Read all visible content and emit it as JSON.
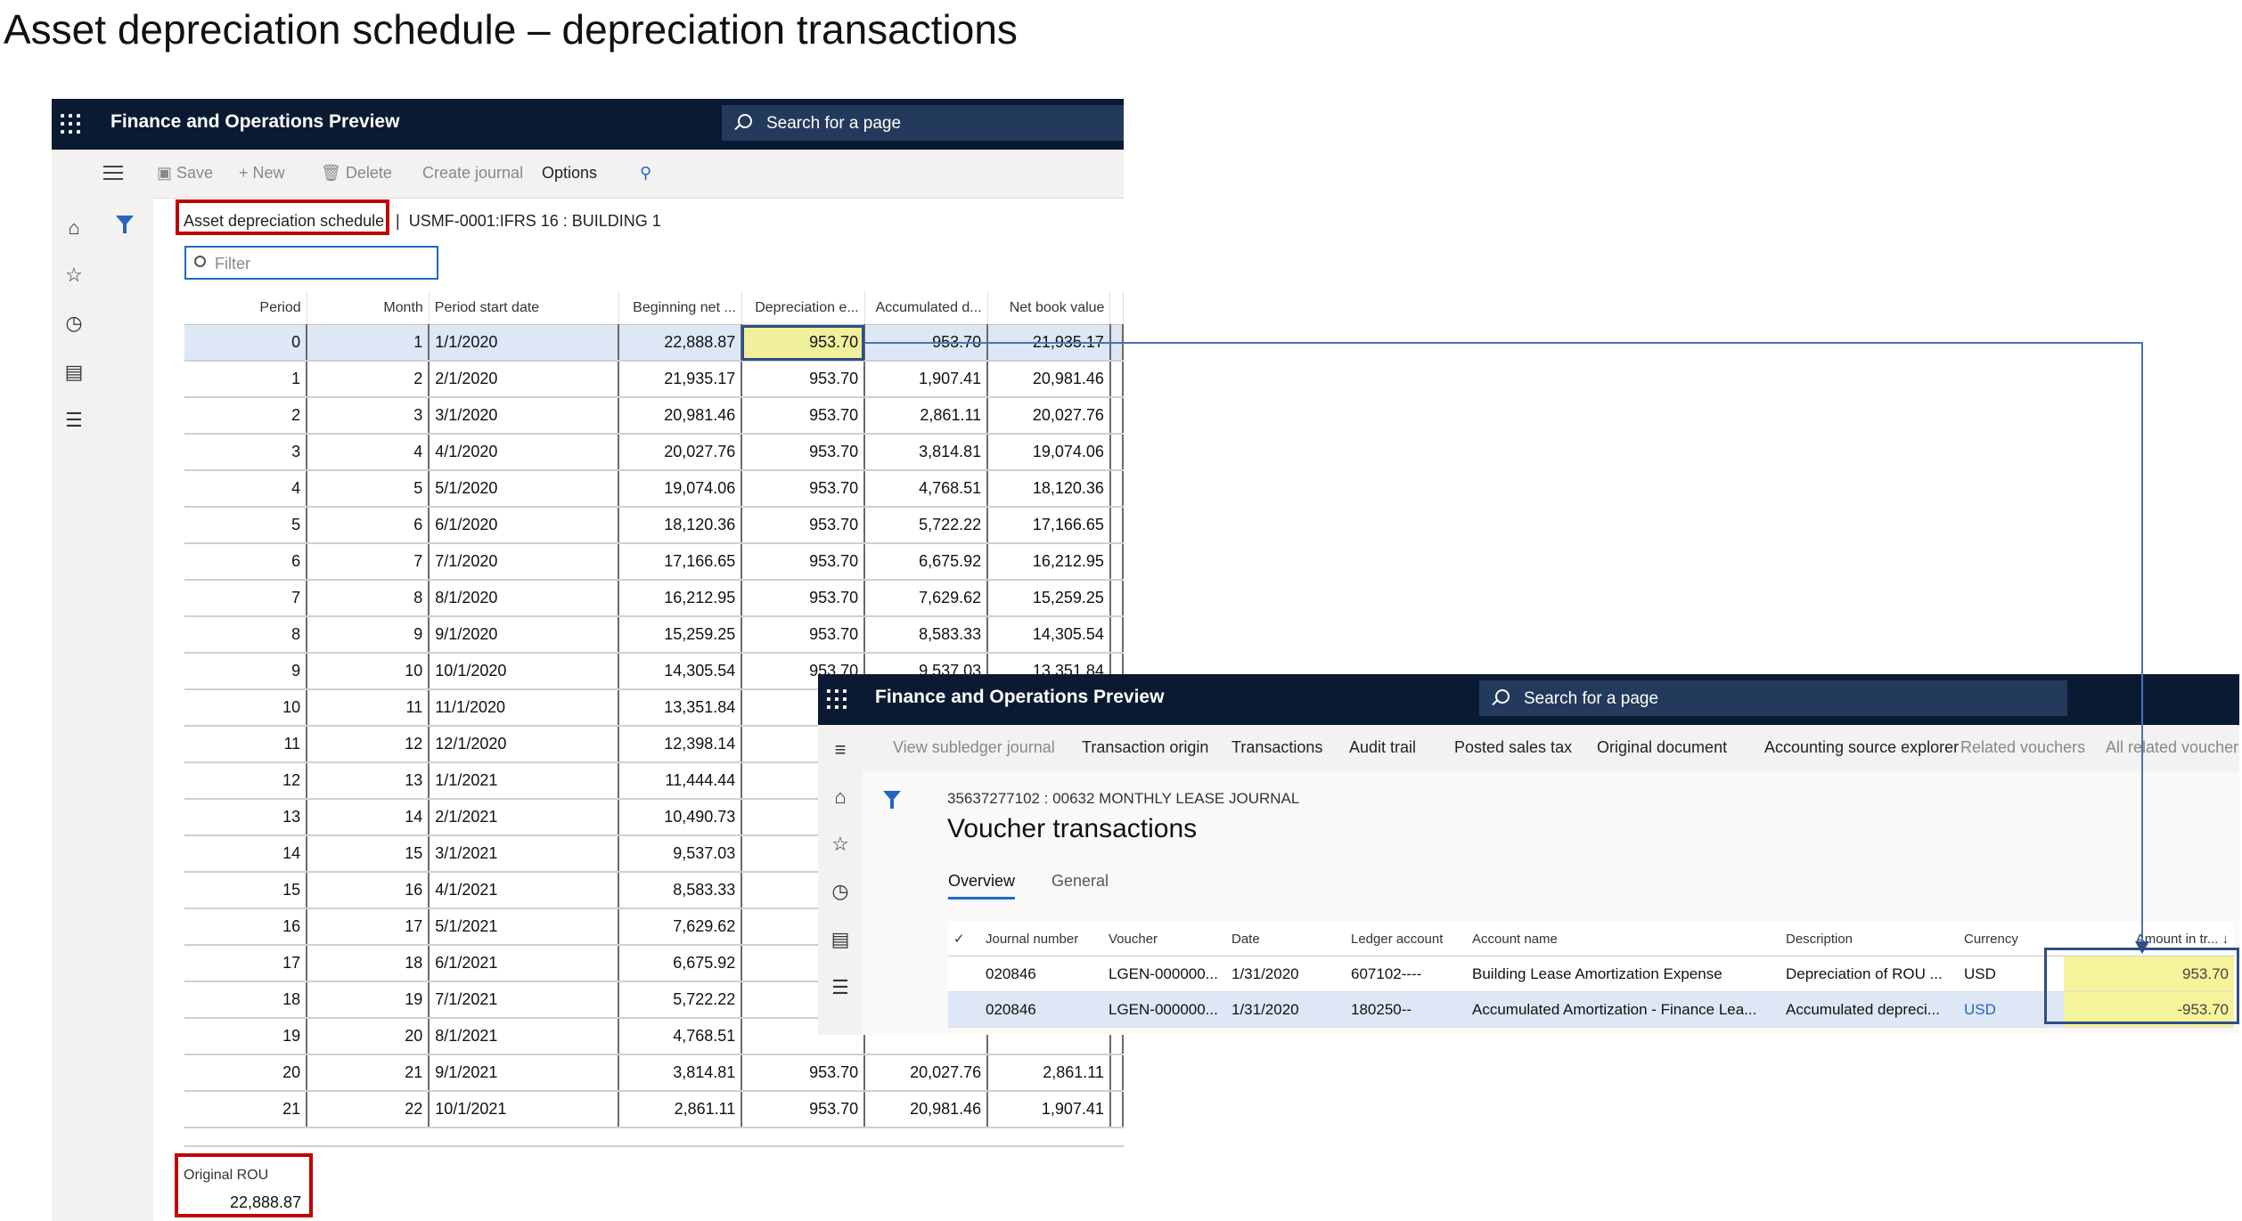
{
  "slide_title": "Asset depreciation schedule – depreciation transactions",
  "app_title": "Finance and Operations Preview",
  "search_placeholder": "Search for a page",
  "schedule": {
    "actions": [
      "Save",
      "New",
      "Delete",
      "Create journal",
      "Options"
    ],
    "breadcrumb": "Asset depreciation schedule",
    "breadcrumb_separator": "|",
    "asset_ref": "USMF-0001:IFRS 16 : BUILDING 1",
    "filter_placeholder": "Filter",
    "columns": [
      "Period",
      "Month",
      "Period start date",
      "Beginning net ...",
      "Depreciation e...",
      "Accumulated d...",
      "Net book value"
    ],
    "rows": [
      [
        "0",
        "1",
        "1/1/2020",
        "22,888.87",
        "953.70",
        "953.70",
        "21,935.17"
      ],
      [
        "1",
        "2",
        "2/1/2020",
        "21,935.17",
        "953.70",
        "1,907.41",
        "20,981.46"
      ],
      [
        "2",
        "3",
        "3/1/2020",
        "20,981.46",
        "953.70",
        "2,861.11",
        "20,027.76"
      ],
      [
        "3",
        "4",
        "4/1/2020",
        "20,027.76",
        "953.70",
        "3,814.81",
        "19,074.06"
      ],
      [
        "4",
        "5",
        "5/1/2020",
        "19,074.06",
        "953.70",
        "4,768.51",
        "18,120.36"
      ],
      [
        "5",
        "6",
        "6/1/2020",
        "18,120.36",
        "953.70",
        "5,722.22",
        "17,166.65"
      ],
      [
        "6",
        "7",
        "7/1/2020",
        "17,166.65",
        "953.70",
        "6,675.92",
        "16,212.95"
      ],
      [
        "7",
        "8",
        "8/1/2020",
        "16,212.95",
        "953.70",
        "7,629.62",
        "15,259.25"
      ],
      [
        "8",
        "9",
        "9/1/2020",
        "15,259.25",
        "953.70",
        "8,583.33",
        "14,305.54"
      ],
      [
        "9",
        "10",
        "10/1/2020",
        "14,305.54",
        "953.70",
        "9,537.03",
        "13,351.84"
      ],
      [
        "10",
        "11",
        "11/1/2020",
        "13,351.84",
        "",
        "",
        ""
      ],
      [
        "11",
        "12",
        "12/1/2020",
        "12,398.14",
        "",
        "",
        ""
      ],
      [
        "12",
        "13",
        "1/1/2021",
        "11,444.44",
        "",
        "",
        ""
      ],
      [
        "13",
        "14",
        "2/1/2021",
        "10,490.73",
        "",
        "",
        ""
      ],
      [
        "14",
        "15",
        "3/1/2021",
        "9,537.03",
        "",
        "",
        ""
      ],
      [
        "15",
        "16",
        "4/1/2021",
        "8,583.33",
        "",
        "",
        ""
      ],
      [
        "16",
        "17",
        "5/1/2021",
        "7,629.62",
        "",
        "",
        ""
      ],
      [
        "17",
        "18",
        "6/1/2021",
        "6,675.92",
        "",
        "",
        ""
      ],
      [
        "18",
        "19",
        "7/1/2021",
        "5,722.22",
        "",
        "",
        ""
      ],
      [
        "19",
        "20",
        "8/1/2021",
        "4,768.51",
        "",
        "",
        ""
      ],
      [
        "20",
        "21",
        "9/1/2021",
        "3,814.81",
        "953.70",
        "20,027.76",
        "2,861.11"
      ],
      [
        "21",
        "22",
        "10/1/2021",
        "2,861.11",
        "953.70",
        "20,981.46",
        "1,907.41"
      ]
    ],
    "original_rou_label": "Original ROU",
    "original_rou_value": "22,888.87"
  },
  "voucher": {
    "actions": [
      "View subledger journal",
      "Transaction origin",
      "Transactions",
      "Audit trail",
      "Posted sales tax",
      "Original document",
      "Accounting source explorer",
      "Related vouchers",
      "All related vouchers"
    ],
    "journal_title": "35637277102 : 00632 MONTHLY LEASE JOURNAL",
    "page_title": "Voucher transactions",
    "tabs": [
      "Overview",
      "General"
    ],
    "columns": [
      "Journal number",
      "Voucher",
      "Date",
      "Ledger account",
      "Account name",
      "Description",
      "Currency",
      "Amount in tr... ↓"
    ],
    "rows": [
      [
        "020846",
        "LGEN-000000...",
        "1/31/2020",
        "607102----",
        "Building Lease Amortization Expense",
        "Depreciation of ROU ...",
        "USD",
        "953.70"
      ],
      [
        "020846",
        "LGEN-000000...",
        "1/31/2020",
        "180250--",
        "Accumulated Amortization - Finance Lea...",
        "Accumulated depreci...",
        "USD",
        "-953.70"
      ]
    ]
  },
  "colors": {
    "nav_bar": "#0b1a33",
    "highlight_yellow": "#f0f09a",
    "callout_red": "#c00000",
    "connector_blue": "#4b72b6",
    "selected_row": "#dde7f6"
  }
}
